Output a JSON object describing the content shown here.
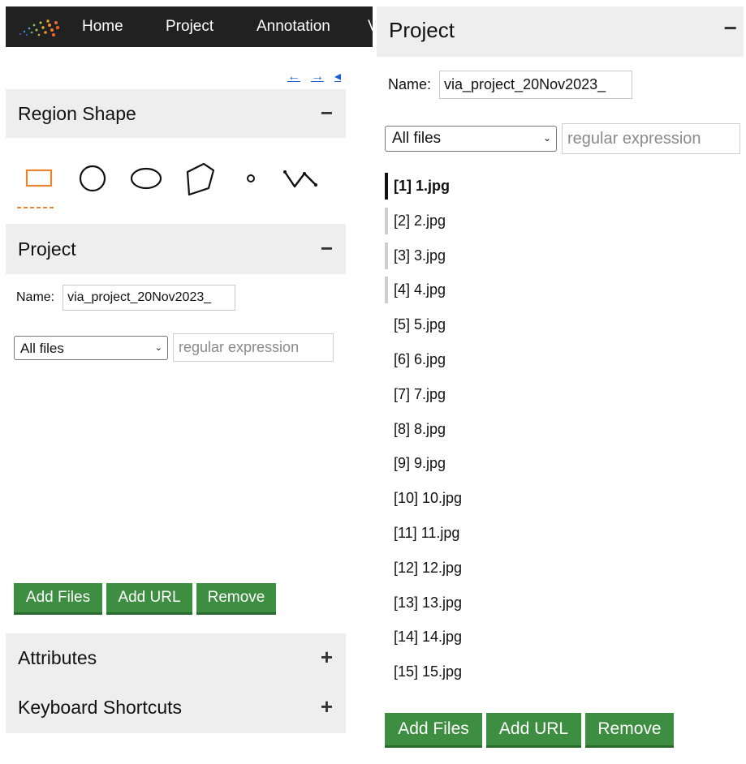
{
  "nav": {
    "items": [
      "Home",
      "Project",
      "Annotation",
      "View"
    ]
  },
  "left_panel": {
    "region_shape": {
      "title": "Region Shape",
      "toggle": "−"
    },
    "shape_icons": [
      "rectangle-icon",
      "circle-icon",
      "ellipse-icon",
      "polygon-icon",
      "point-icon",
      "polyline-icon"
    ],
    "project": {
      "title": "Project",
      "toggle": "−",
      "name_label": "Name:",
      "name_value": "via_project_20Nov2023_",
      "filter_selected": "All files",
      "regex_placeholder": "regular expression",
      "buttons": {
        "add_files": "Add Files",
        "add_url": "Add URL",
        "remove": "Remove"
      }
    },
    "attributes": {
      "title": "Attributes",
      "toggle": "+"
    },
    "shortcuts": {
      "title": "Keyboard Shortcuts",
      "toggle": "+"
    }
  },
  "right_panel": {
    "project": {
      "title": "Project",
      "toggle": "−",
      "name_label": "Name:",
      "name_value": "via_project_20Nov2023_",
      "filter_selected": "All files",
      "regex_placeholder": "regular expression",
      "files": [
        "[1] 1.jpg",
        "[2] 2.jpg",
        "[3] 3.jpg",
        "[4] 4.jpg",
        "[5] 5.jpg",
        "[6] 6.jpg",
        "[7] 7.jpg",
        "[8] 8.jpg",
        "[9] 9.jpg",
        "[10] 10.jpg",
        "[11] 11.jpg",
        "[12] 12.jpg",
        "[13] 13.jpg",
        "[14] 14.jpg",
        "[15] 15.jpg"
      ],
      "buttons": {
        "add_files": "Add Files",
        "add_url": "Add URL",
        "remove": "Remove"
      }
    }
  },
  "colors": {
    "nav_bg": "#212121",
    "section_bg": "#eeeeee",
    "button_green": "#3e8e41",
    "shape_active": "#e8842e",
    "link_blue": "#1a5fd6"
  }
}
